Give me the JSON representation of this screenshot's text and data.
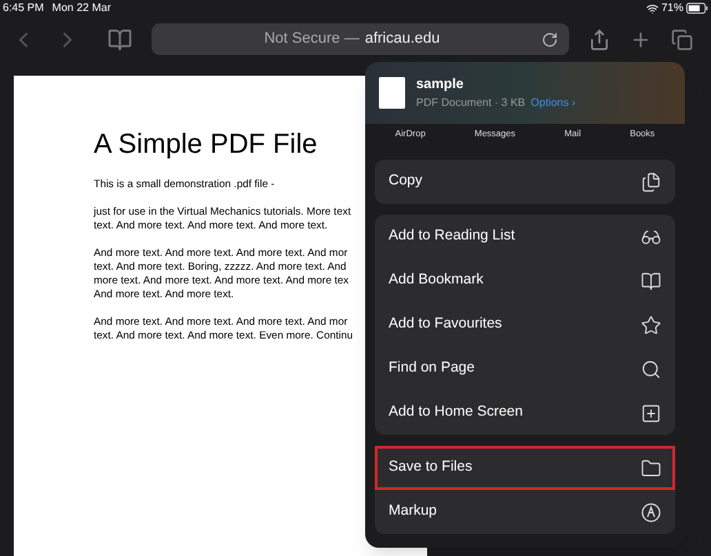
{
  "status_bar": {
    "time": "6:45 PM",
    "date": "Mon 22 Mar",
    "battery": "71%"
  },
  "toolbar": {
    "address": {
      "prefix": "Not Secure —",
      "domain": "africau.edu"
    },
    "back_disabled": true,
    "forward_disabled": true
  },
  "document": {
    "title": "A Simple PDF File",
    "paragraphs": [
      [
        "This is a small demonstration .pdf file -"
      ],
      [
        "just for use in the Virtual Mechanics tutorials. More text",
        "text. And more text. And more text. And more text."
      ],
      [
        "And more text. And more text. And more text. And mor",
        "text. And more text. Boring, zzzzz. And more text. And",
        "more text. And more text. And more text. And more tex",
        "And more text. And more text."
      ],
      [
        "And more text. And more text. And more text. And mor",
        "text. And more text. And more text. Even more. Continu"
      ]
    ]
  },
  "share_sheet": {
    "file": {
      "name": "sample",
      "details": "PDF Document · 3 KB",
      "options": "Options ›"
    },
    "apps": [
      "AirDrop",
      "Messages",
      "Mail",
      "Books"
    ],
    "groups": [
      [
        {
          "label": "Copy",
          "highlighted": false
        }
      ],
      [
        {
          "label": "Add to Reading List",
          "highlighted": false
        },
        {
          "label": "Add Bookmark",
          "highlighted": false
        },
        {
          "label": "Add to Favourites",
          "highlighted": false
        },
        {
          "label": "Find on Page",
          "highlighted": false
        },
        {
          "label": "Add to Home Screen",
          "highlighted": false
        }
      ],
      [
        {
          "label": "Save to Files",
          "highlighted": true
        },
        {
          "label": "Markup",
          "highlighted": false
        }
      ]
    ]
  }
}
